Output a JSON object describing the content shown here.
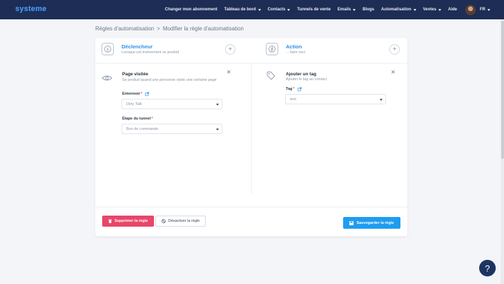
{
  "header": {
    "logo": "systeme",
    "nav": [
      {
        "label": "Changer mon abonnement",
        "dropdown": false
      },
      {
        "label": "Tableau de bord",
        "dropdown": true
      },
      {
        "label": "Contacts",
        "dropdown": true
      },
      {
        "label": "Tunnels de vente",
        "dropdown": false
      },
      {
        "label": "Emails",
        "dropdown": true
      },
      {
        "label": "Blogs",
        "dropdown": false
      },
      {
        "label": "Automatisation",
        "dropdown": true
      },
      {
        "label": "Ventes",
        "dropdown": true
      },
      {
        "label": "Aide",
        "dropdown": false
      }
    ],
    "language": "FR"
  },
  "breadcrumb": {
    "parent": "Règles d'automatisation",
    "separator": ">",
    "current": "Modifier la règle d'automatisation"
  },
  "trigger": {
    "title": "Déclencheur",
    "subtitle": "Lorsque cet événement se produit",
    "item": {
      "title": "Page visitée",
      "description": "Se produit quand une personne visite une certaine page",
      "funnel_label": "Entonnoir",
      "funnel_value": "Dirty Talk",
      "step_label": "Étape du tunnel",
      "step_value": "Bon de commande"
    }
  },
  "action": {
    "title": "Action",
    "subtitle": "... faire ceci",
    "item": {
      "title": "Ajouter un tag",
      "description": "Ajouter le tag au contact",
      "tag_label": "Tag",
      "tag_value": "test"
    }
  },
  "buttons": {
    "delete": "Supprimer la règle",
    "disable": "Désactiver la règle",
    "save": "Sauvegarder la règle"
  },
  "help": "?",
  "colors": {
    "topbar": "#1d2d55",
    "accent": "#2e8fe8",
    "danger": "#e8466a",
    "primary": "#1e9cf0"
  }
}
